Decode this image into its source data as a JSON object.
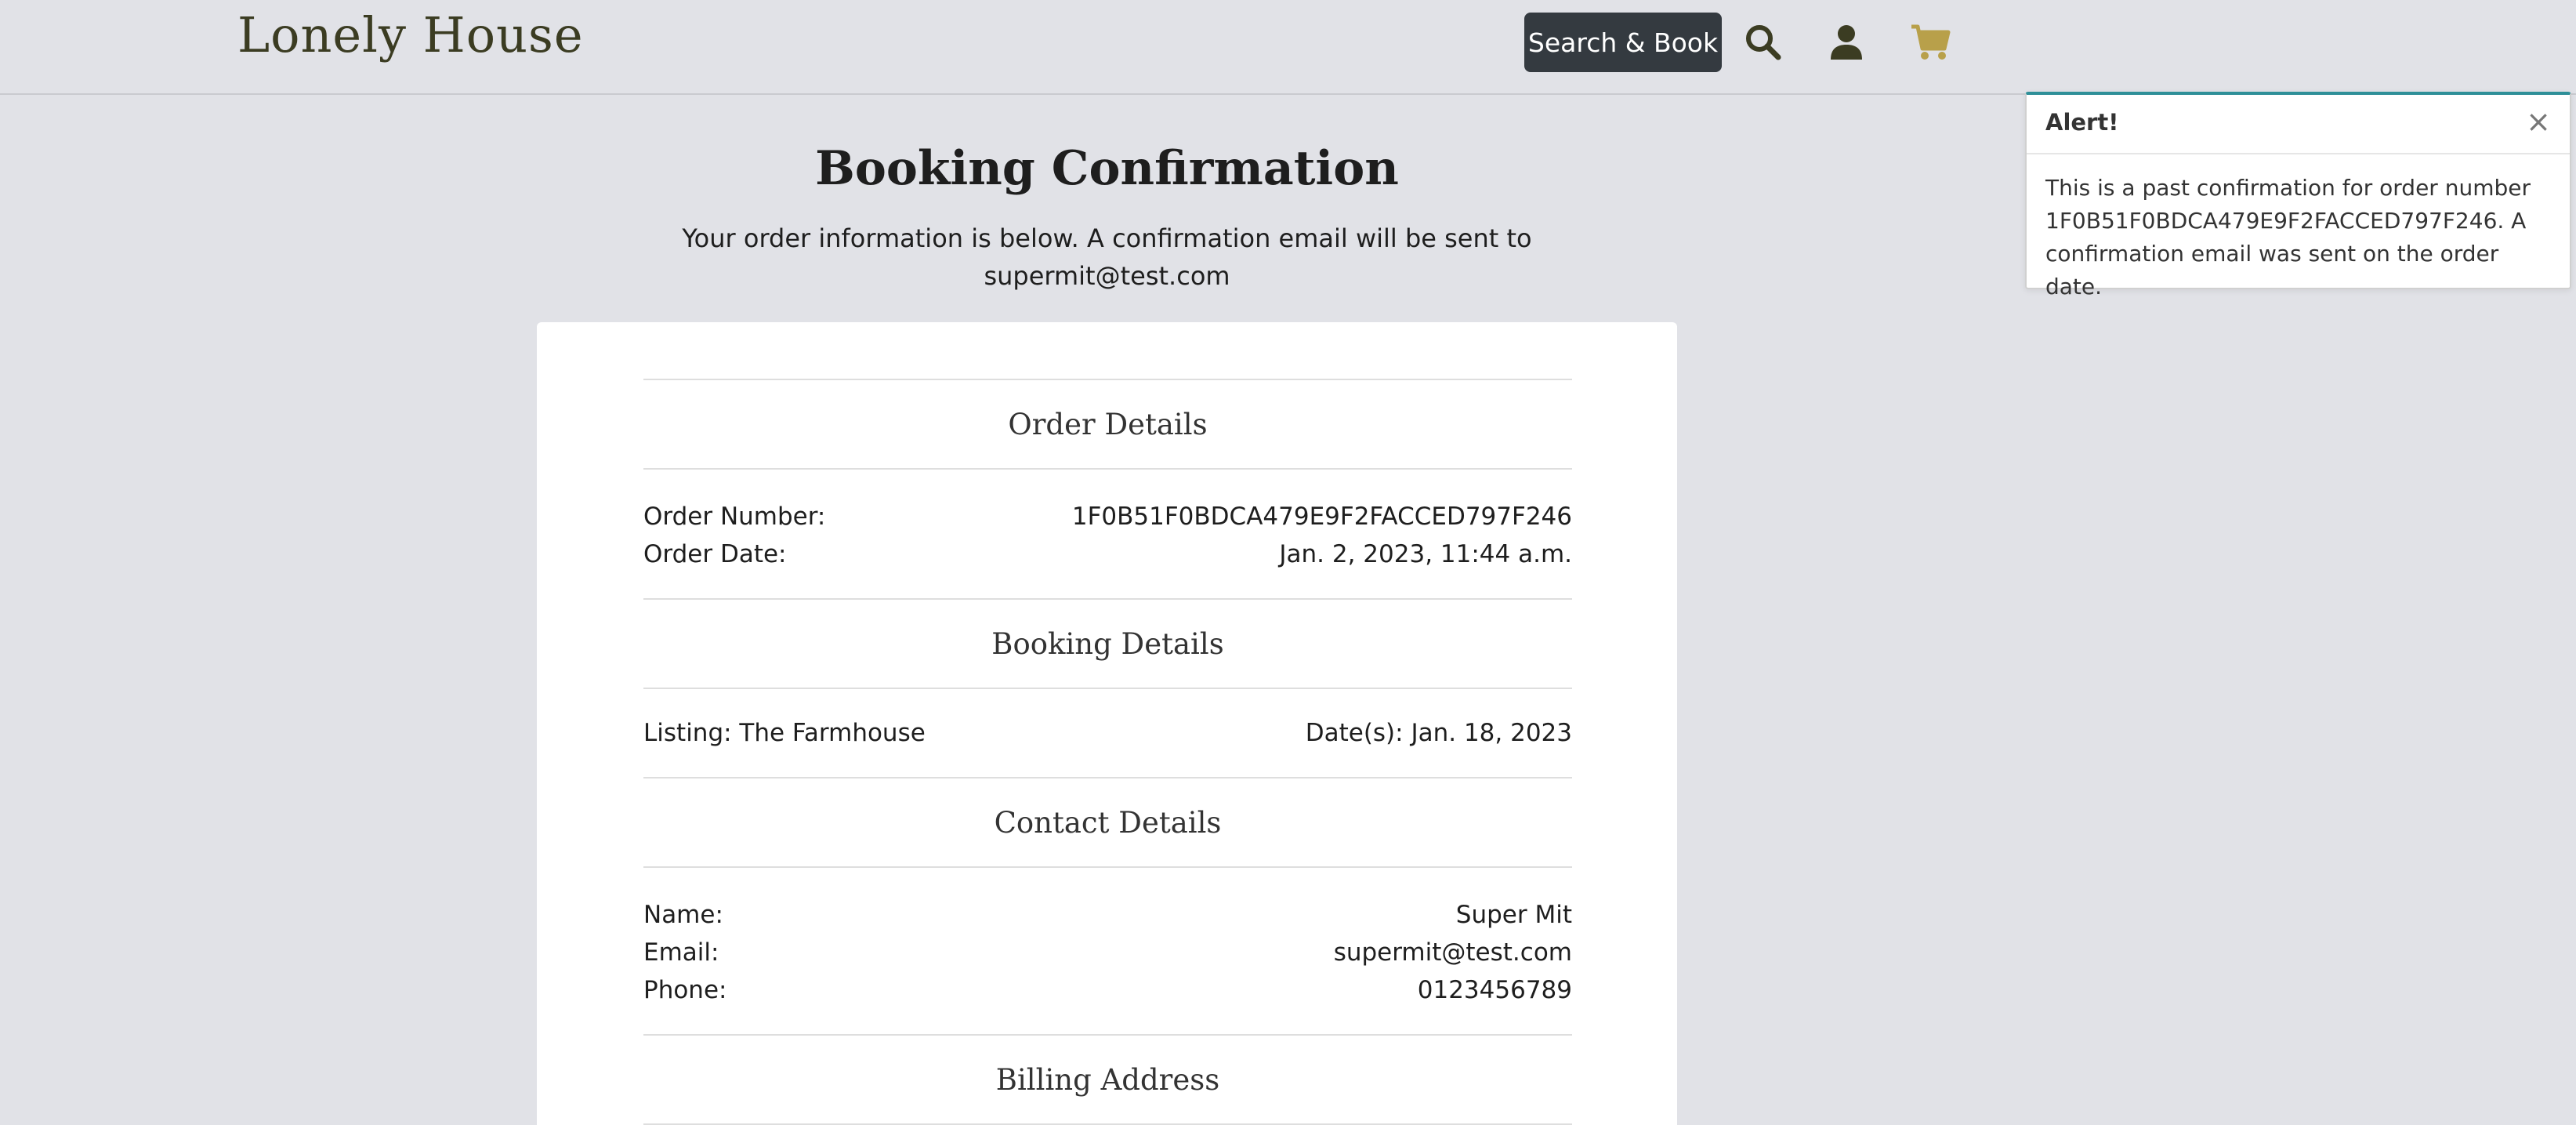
{
  "navbar": {
    "brand": "Lonely House",
    "search_book_label": "Search & Book",
    "icons": [
      "search-icon",
      "user-icon",
      "cart-icon"
    ],
    "cart_color": "#b8a04a",
    "icon_color": "#3b3c22"
  },
  "page": {
    "title": "Booking Confirmation",
    "subtitle": "Your order information is below. A confirmation email will be sent to supermit@test.com"
  },
  "order_details": {
    "heading": "Order Details",
    "order_number_label": "Order Number:",
    "order_number_value": "1F0B51F0BDCA479E9F2FACCED797F246",
    "order_date_label": "Order Date:",
    "order_date_value": "Jan. 2, 2023, 11:44 a.m."
  },
  "booking_details": {
    "heading": "Booking Details",
    "listing": "Listing: The Farmhouse",
    "dates": "Date(s): Jan. 18, 2023"
  },
  "contact_details": {
    "heading": "Contact Details",
    "name_label": "Name:",
    "name_value": "Super Mit",
    "email_label": "Email:",
    "email_value": "supermit@test.com",
    "phone_label": "Phone:",
    "phone_value": "0123456789"
  },
  "billing_address": {
    "heading": "Billing Address"
  },
  "alert": {
    "title": "Alert!",
    "close_symbol": "×",
    "message": "This is a past confirmation for order number 1F0B51F0BDCA479E9F2FACCED797F246. A confirmation email was sent on the order date.",
    "accent_color": "#2e8f98"
  }
}
